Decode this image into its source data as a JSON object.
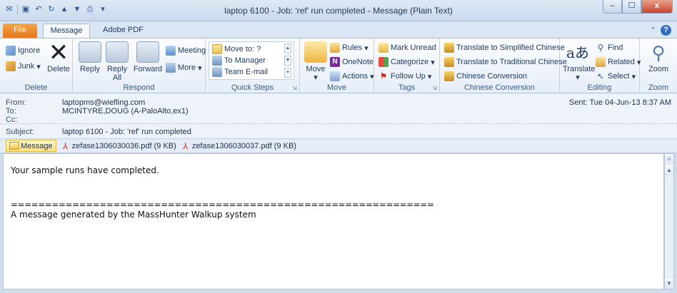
{
  "window": {
    "title": "laptop 6100 - Job: 'ref' run completed  -  Message (Plain Text)",
    "controls": {
      "minimize": "–",
      "maximize": "☐",
      "close": "x"
    }
  },
  "tabs": [
    {
      "label": "File"
    },
    {
      "label": "Message"
    },
    {
      "label": "Adobe PDF"
    }
  ],
  "ribbon": {
    "delete": {
      "group": "Delete",
      "ignore": "Ignore",
      "junk": "Junk",
      "delete": "Delete"
    },
    "respond": {
      "group": "Respond",
      "reply": "Reply",
      "reply_all_1": "Reply",
      "reply_all_2": "All",
      "forward": "Forward",
      "meeting": "Meeting",
      "more": "More"
    },
    "quick_steps": {
      "group": "Quick Steps",
      "items": [
        "Move to: ?",
        "To Manager",
        "Team E-mail"
      ]
    },
    "move": {
      "group": "Move",
      "move": "Move",
      "rules": "Rules",
      "onenote": "OneNote",
      "actions": "Actions"
    },
    "tags": {
      "group": "Tags",
      "mark_unread": "Mark Unread",
      "categorize": "Categorize",
      "follow_up": "Follow Up"
    },
    "chinese": {
      "group": "Chinese Conversion",
      "simplified": "Translate to Simplified Chinese",
      "traditional": "Translate to Traditional Chinese",
      "conversion": "Chinese Conversion"
    },
    "editing": {
      "group": "Editing",
      "translate": "Translate",
      "find": "Find",
      "related": "Related",
      "select": "Select"
    },
    "zoom": {
      "group": "Zoom",
      "zoom": "Zoom"
    }
  },
  "header": {
    "from_label": "From:",
    "from": "laptopms@wiefling.com",
    "to_label": "To:",
    "to": "MCINTYRE,DOUG (A-PaloAlto,ex1)",
    "cc_label": "Cc:",
    "cc": "",
    "subject_label": "Subject:",
    "subject": "laptop 6100 - Job: 'ref' run completed",
    "sent_label": "Sent:",
    "sent": "Tue 04-Jun-13 8:37 AM"
  },
  "attachments": [
    {
      "name": "Message"
    },
    {
      "name": "zefase1306030036.pdf (9 KB)"
    },
    {
      "name": "zefase1306030037.pdf (9 KB)"
    }
  ],
  "body": {
    "line1": "Your sample runs have completed.",
    "separator": "==============================================================",
    "line2": "A message generated by the MassHunter Walkup system"
  }
}
